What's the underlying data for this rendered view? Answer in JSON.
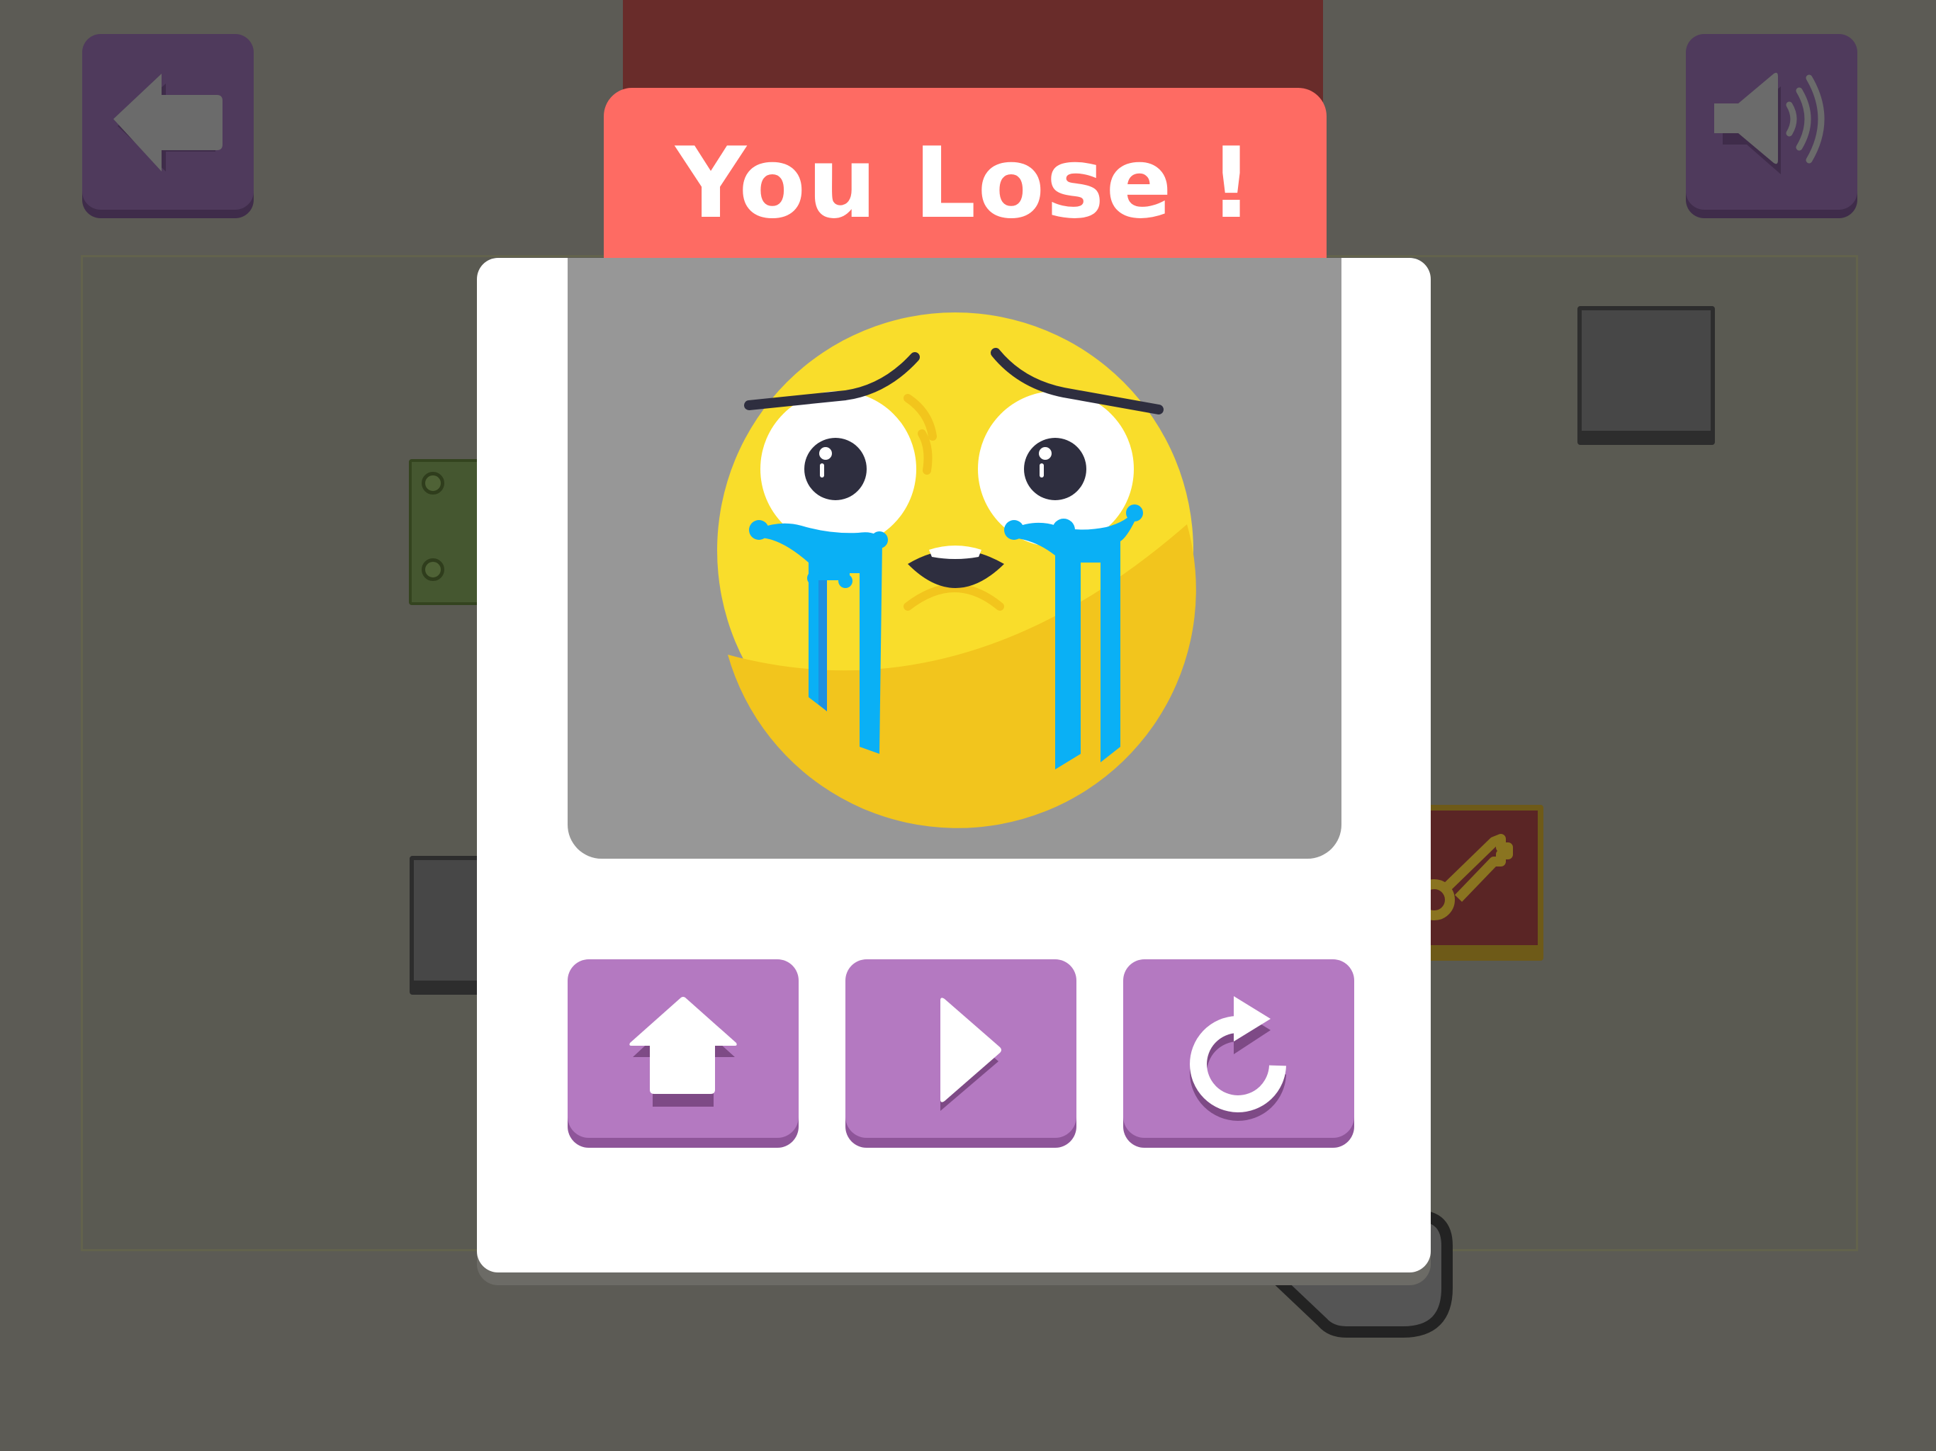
{
  "colors": {
    "background": "#5c5b55",
    "title_tab": "#fe6b63",
    "modal": "#ffffff",
    "image_panel": "#979797",
    "action_button": "#b479c1",
    "action_button_shadow": "#8e5599",
    "top_button": "#4f3a5c",
    "emoji_face": "#f9dd2b",
    "tears": "#0ab0f5"
  },
  "modal": {
    "title": "You Lose !",
    "image_icon": "crying-face-emoji"
  },
  "buttons": {
    "home_icon": "home-icon",
    "play_icon": "play-icon",
    "restart_icon": "restart-icon",
    "back_icon": "back-arrow-icon",
    "sound_icon": "speaker-volume-icon"
  }
}
